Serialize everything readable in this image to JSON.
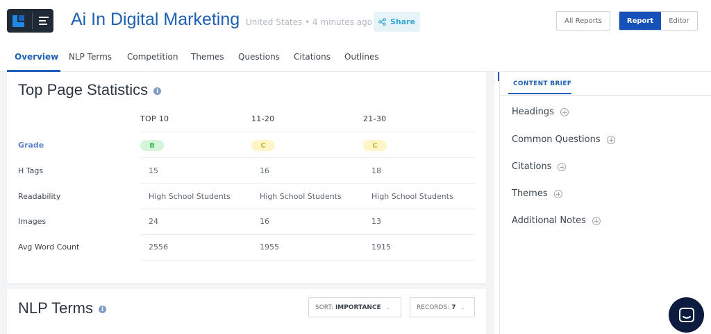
{
  "header": {
    "title": "Ai In Digital Marketing",
    "meta": "United States • 4 minutes ago",
    "share_label": "Share",
    "all_reports_label": "All Reports",
    "report_label": "Report",
    "editor_label": "Editor"
  },
  "tabs": [
    {
      "label": "Overview"
    },
    {
      "label": "NLP Terms"
    },
    {
      "label": "Competition"
    },
    {
      "label": "Themes"
    },
    {
      "label": "Questions"
    },
    {
      "label": "Citations"
    },
    {
      "label": "Outlines"
    }
  ],
  "stats": {
    "title": "Top Page Statistics",
    "columns": [
      "TOP 10",
      "11-20",
      "21-30"
    ],
    "rows": [
      {
        "label": "Grade",
        "values": [
          "B",
          "C",
          "C"
        ]
      },
      {
        "label": "H Tags",
        "values": [
          "15",
          "16",
          "18"
        ]
      },
      {
        "label": "Readability",
        "values": [
          "High School Students",
          "High School Students",
          "High School Students"
        ]
      },
      {
        "label": "Images",
        "values": [
          "24",
          "16",
          "13"
        ]
      },
      {
        "label": "Avg Word Count",
        "values": [
          "2556",
          "1955",
          "1915"
        ]
      }
    ]
  },
  "nlp": {
    "title": "NLP Terms",
    "sort_prefix": "SORT:",
    "sort_value": "IMPORTANCE",
    "records_prefix": "RECORDS:",
    "records_value": "7"
  },
  "brief": {
    "tab_label": "CONTENT BRIEF",
    "items": [
      {
        "label": "Headings"
      },
      {
        "label": "Common Questions"
      },
      {
        "label": "Citations"
      },
      {
        "label": "Themes"
      },
      {
        "label": "Additional Notes"
      }
    ]
  },
  "colors": {
    "accent": "#1e60b4",
    "primary_button": "#1551b8",
    "grade_b": "#3dbb57",
    "grade_c": "#d9b32a"
  },
  "icons": [
    "app-logo-icon",
    "menu-icon",
    "share-icon",
    "info-icon",
    "chevron-down-icon",
    "plus-circle-icon",
    "chat-icon"
  ]
}
